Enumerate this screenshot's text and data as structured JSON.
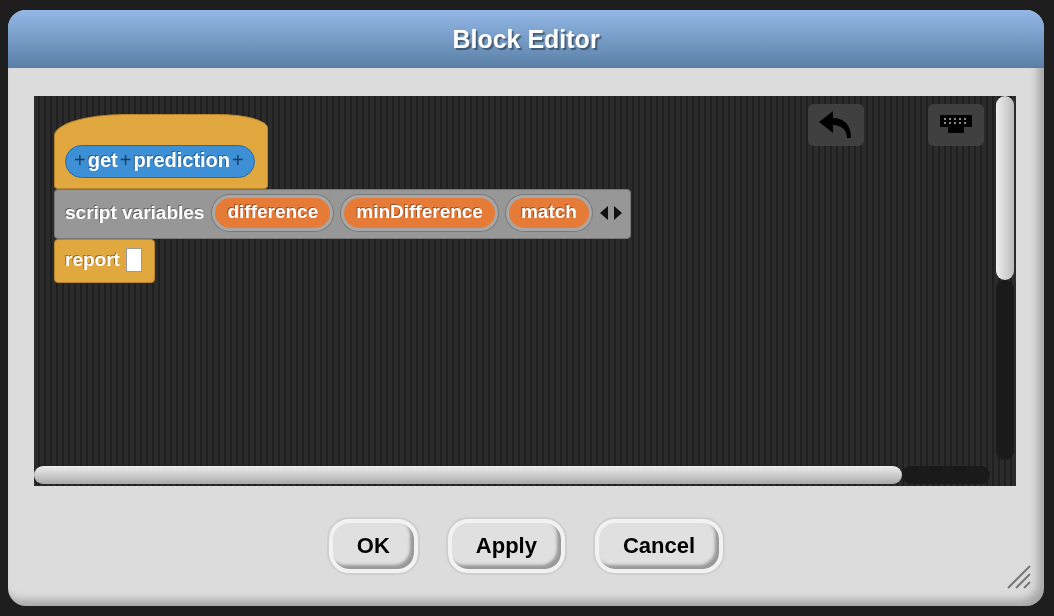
{
  "window": {
    "title": "Block Editor"
  },
  "blocks": [
    {
      "kind": "hat",
      "parts": [
        "+",
        "get",
        "+",
        "prediction",
        "+"
      ]
    },
    {
      "kind": "variables",
      "label": "script variables",
      "variables": [
        "difference",
        "minDifference",
        "match"
      ]
    },
    {
      "kind": "report",
      "label": "report"
    }
  ],
  "buttons": [
    "OK",
    "Apply",
    "Cancel"
  ]
}
